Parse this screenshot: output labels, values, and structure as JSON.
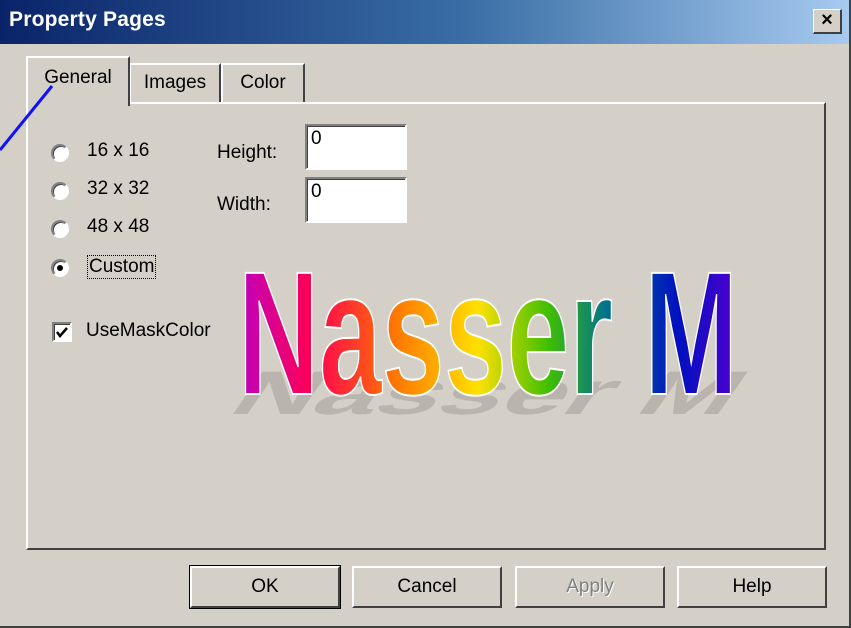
{
  "window": {
    "title": "Property Pages",
    "close_symbol": "×",
    "colors": {
      "title_start": "#0a246a",
      "title_end": "#a6caf0",
      "face": "#d4d0c8"
    }
  },
  "tabs": [
    {
      "label": "General",
      "active": true
    },
    {
      "label": "Images",
      "active": false
    },
    {
      "label": "Color",
      "active": false
    }
  ],
  "general": {
    "size_options": [
      {
        "label": "16 x 16",
        "selected": false
      },
      {
        "label": "32 x 32",
        "selected": false
      },
      {
        "label": "48 x 48",
        "selected": false
      },
      {
        "label": "Custom",
        "selected": true
      }
    ],
    "height": {
      "label": "Height:",
      "value": "0"
    },
    "width": {
      "label": "Width:",
      "value": "0"
    },
    "use_mask_color": {
      "label": "UseMaskColor",
      "checked": true
    }
  },
  "watermark": {
    "text": "Nasser M",
    "gradient_colors": [
      "#c000c0",
      "#ff0050",
      "#ff7a00",
      "#ffe000",
      "#40c000",
      "#007090",
      "#0010c0",
      "#5000d0"
    ]
  },
  "buttons": {
    "ok": "OK",
    "cancel": "Cancel",
    "apply": "Apply",
    "help": "Help"
  }
}
